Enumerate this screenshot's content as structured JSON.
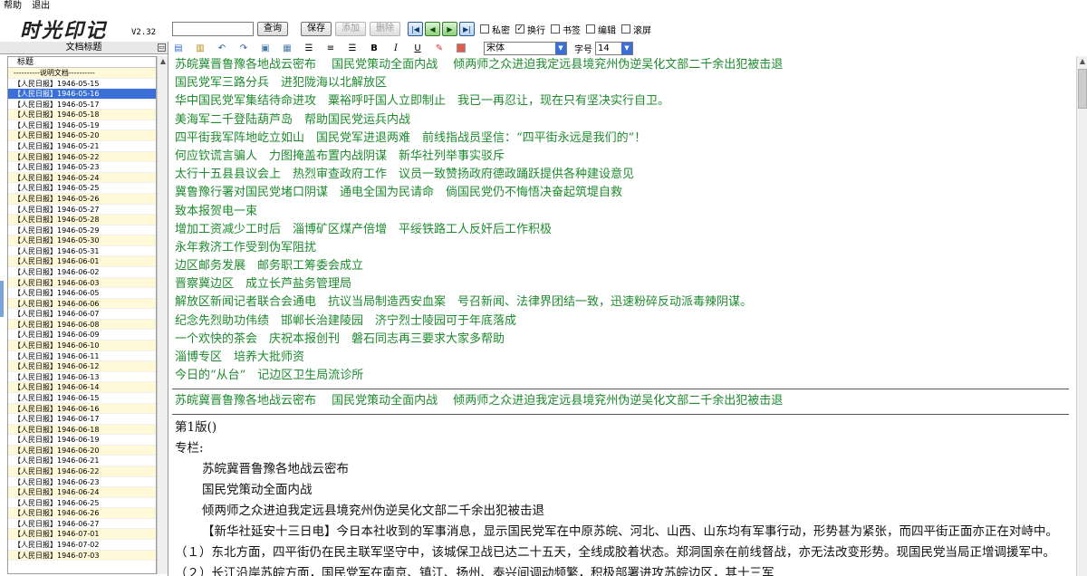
{
  "menu": {
    "help": "帮助",
    "exit": "退出"
  },
  "app": {
    "logo": "时光印记",
    "version": "V2.32"
  },
  "toolbar": {
    "search_value": "",
    "query": "查询",
    "save": "保存",
    "add": "添加",
    "delete": "删除",
    "private": "私密",
    "wrap": "换行",
    "bookmark": "书签",
    "edit": "编辑",
    "scroll": "滚屏",
    "private_checked": false,
    "wrap_checked": true,
    "bookmark_checked": false,
    "edit_checked": false,
    "scroll_checked": false
  },
  "panel": {
    "title": "文档标题",
    "column": "标题"
  },
  "tree": [
    "----------说明文档----------",
    "【人民日报】1946-05-15",
    "【人民日报】1946-05-16",
    "【人民日报】1946-05-17",
    "【人民日报】1946-05-18",
    "【人民日报】1946-05-19",
    "【人民日报】1946-05-20",
    "【人民日报】1946-05-21",
    "【人民日报】1946-05-22",
    "【人民日报】1946-05-23",
    "【人民日报】1946-05-24",
    "【人民日报】1946-05-25",
    "【人民日报】1946-05-26",
    "【人民日报】1946-05-27",
    "【人民日报】1946-05-28",
    "【人民日报】1946-05-29",
    "【人民日报】1946-05-30",
    "【人民日报】1946-05-31",
    "【人民日报】1946-06-01",
    "【人民日报】1946-06-02",
    "【人民日报】1946-06-03",
    "【人民日报】1946-06-05",
    "【人民日报】1946-06-06",
    "【人民日报】1946-06-07",
    "【人民日报】1946-06-08",
    "【人民日报】1946-06-09",
    "【人民日报】1946-06-10",
    "【人民日报】1946-06-11",
    "【人民日报】1946-06-12",
    "【人民日报】1946-06-13",
    "【人民日报】1946-06-14",
    "【人民日报】1946-06-15",
    "【人民日报】1946-06-16",
    "【人民日报】1946-06-17",
    "【人民日报】1946-06-18",
    "【人民日报】1946-06-19",
    "【人民日报】1946-06-20",
    "【人民日报】1946-06-21",
    "【人民日报】1946-06-22",
    "【人民日报】1946-06-23",
    "【人民日报】1946-06-24",
    "【人民日报】1946-06-25",
    "【人民日报】1946-06-26",
    "【人民日报】1946-06-27",
    "【人民日报】1946-07-01",
    "【人民日报】1946-07-02",
    "【人民日报】1946-07-03"
  ],
  "format": {
    "font": "宋体",
    "size_label": "字号",
    "size": "14"
  },
  "headlines": [
    "苏皖冀晋鲁豫各地战云密布　 国民党策动全面内战　 倾两师之众进迫我定远县境兖州伪逆吴化文部二千余出犯被击退",
    "国民党军三路分兵　进犯陇海以北解放区",
    "华中国民党军集结待命进攻　粟裕呼吁国人立即制止　我已一再忍让，现在只有坚决实行自卫。",
    "美海军二千登陆葫芦岛　帮助国民党运兵内战",
    "四平街我军阵地屹立如山　国民党军进退两难　前线指战员坚信：“四平街永远是我们的”！",
    "何应钦谎言骗人　力图掩盖布置内战阴谋　新华社列举事实驳斥",
    "太行十五县县议会上　热烈审查政府工作　议员一致赞扬政府德政踊跃提供各种建设意见",
    "冀鲁豫行署对国民党堵口阴谋　通电全国为民请命　倘国民党仍不悔悟决奋起筑堤自救",
    "致本报贺电一束",
    "增加工资减少工时后　淄博矿区煤产倍增　平绥铁路工人反奸后工作积极",
    "永年救济工作受到伪军阻扰",
    "边区邮务发展　邮务职工筹委会成立",
    "晋察冀边区　成立长芦盐务管理局",
    "解放区新闻记者联合会通电　抗议当局制造西安血案　号召新闻、法律界团结一致，迅速粉碎反动派毒辣阴谋。",
    "纪念先烈助功伟绩　邯郸长治建陵园　济宁烈士陵园可于年底落成",
    "一个欢快的茶会　庆祝本报创刊　磐石同志再三要求大家多帮助",
    "淄博专区　培养大批师资",
    "今日的“从台”　记边区卫生局流诊所"
  ],
  "current": "苏皖冀晋鲁豫各地战云密布　 国民党策动全面内战　 倾两师之众进迫我定远县境兖州伪逆吴化文部二千余出犯被击退",
  "article": {
    "edition": "第1版()",
    "column": "专栏:",
    "titles": [
      "苏皖冀晋鲁豫各地战云密布",
      "国民党策动全面内战",
      "倾两师之众进迫我定远县境兖州伪逆吴化文部二千余出犯被击退"
    ],
    "body": "【新华社延安十三日电】今日本社收到的军事消息，显示国民党军在中原苏皖、河北、山西、山东均有军事行动，形势甚为紧张，而四平街正面亦正在对峙中。（１）东北方面，四平街仍在民主联军坚守中，该城保卫战已达二十五天，全线成胶着状态。郑洞国亲在前线督战，亦无法改变形势。现国民党当局正增调援军中。（２）长江沿岸苏皖方面，国民党军在南京、镇江、扬州、泰兴间调动频繁，积极部署进攻苏皖边区，其十三军"
  }
}
